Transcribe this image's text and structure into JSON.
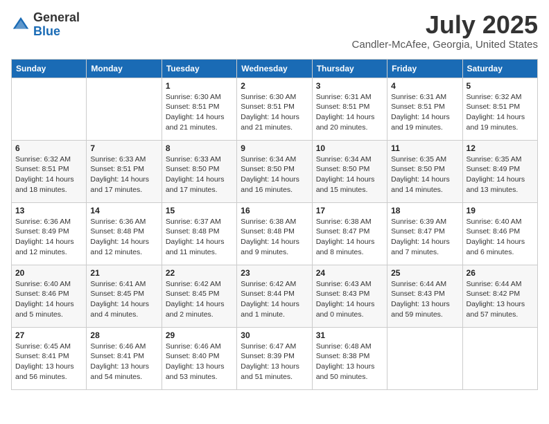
{
  "header": {
    "logo_general": "General",
    "logo_blue": "Blue",
    "month_title": "July 2025",
    "location": "Candler-McAfee, Georgia, United States"
  },
  "days_of_week": [
    "Sunday",
    "Monday",
    "Tuesday",
    "Wednesday",
    "Thursday",
    "Friday",
    "Saturday"
  ],
  "weeks": [
    [
      {
        "day": "",
        "info": ""
      },
      {
        "day": "",
        "info": ""
      },
      {
        "day": "1",
        "info": "Sunrise: 6:30 AM\nSunset: 8:51 PM\nDaylight: 14 hours and 21 minutes."
      },
      {
        "day": "2",
        "info": "Sunrise: 6:30 AM\nSunset: 8:51 PM\nDaylight: 14 hours and 21 minutes."
      },
      {
        "day": "3",
        "info": "Sunrise: 6:31 AM\nSunset: 8:51 PM\nDaylight: 14 hours and 20 minutes."
      },
      {
        "day": "4",
        "info": "Sunrise: 6:31 AM\nSunset: 8:51 PM\nDaylight: 14 hours and 19 minutes."
      },
      {
        "day": "5",
        "info": "Sunrise: 6:32 AM\nSunset: 8:51 PM\nDaylight: 14 hours and 19 minutes."
      }
    ],
    [
      {
        "day": "6",
        "info": "Sunrise: 6:32 AM\nSunset: 8:51 PM\nDaylight: 14 hours and 18 minutes."
      },
      {
        "day": "7",
        "info": "Sunrise: 6:33 AM\nSunset: 8:51 PM\nDaylight: 14 hours and 17 minutes."
      },
      {
        "day": "8",
        "info": "Sunrise: 6:33 AM\nSunset: 8:50 PM\nDaylight: 14 hours and 17 minutes."
      },
      {
        "day": "9",
        "info": "Sunrise: 6:34 AM\nSunset: 8:50 PM\nDaylight: 14 hours and 16 minutes."
      },
      {
        "day": "10",
        "info": "Sunrise: 6:34 AM\nSunset: 8:50 PM\nDaylight: 14 hours and 15 minutes."
      },
      {
        "day": "11",
        "info": "Sunrise: 6:35 AM\nSunset: 8:50 PM\nDaylight: 14 hours and 14 minutes."
      },
      {
        "day": "12",
        "info": "Sunrise: 6:35 AM\nSunset: 8:49 PM\nDaylight: 14 hours and 13 minutes."
      }
    ],
    [
      {
        "day": "13",
        "info": "Sunrise: 6:36 AM\nSunset: 8:49 PM\nDaylight: 14 hours and 12 minutes."
      },
      {
        "day": "14",
        "info": "Sunrise: 6:36 AM\nSunset: 8:48 PM\nDaylight: 14 hours and 12 minutes."
      },
      {
        "day": "15",
        "info": "Sunrise: 6:37 AM\nSunset: 8:48 PM\nDaylight: 14 hours and 11 minutes."
      },
      {
        "day": "16",
        "info": "Sunrise: 6:38 AM\nSunset: 8:48 PM\nDaylight: 14 hours and 9 minutes."
      },
      {
        "day": "17",
        "info": "Sunrise: 6:38 AM\nSunset: 8:47 PM\nDaylight: 14 hours and 8 minutes."
      },
      {
        "day": "18",
        "info": "Sunrise: 6:39 AM\nSunset: 8:47 PM\nDaylight: 14 hours and 7 minutes."
      },
      {
        "day": "19",
        "info": "Sunrise: 6:40 AM\nSunset: 8:46 PM\nDaylight: 14 hours and 6 minutes."
      }
    ],
    [
      {
        "day": "20",
        "info": "Sunrise: 6:40 AM\nSunset: 8:46 PM\nDaylight: 14 hours and 5 minutes."
      },
      {
        "day": "21",
        "info": "Sunrise: 6:41 AM\nSunset: 8:45 PM\nDaylight: 14 hours and 4 minutes."
      },
      {
        "day": "22",
        "info": "Sunrise: 6:42 AM\nSunset: 8:45 PM\nDaylight: 14 hours and 2 minutes."
      },
      {
        "day": "23",
        "info": "Sunrise: 6:42 AM\nSunset: 8:44 PM\nDaylight: 14 hours and 1 minute."
      },
      {
        "day": "24",
        "info": "Sunrise: 6:43 AM\nSunset: 8:43 PM\nDaylight: 14 hours and 0 minutes."
      },
      {
        "day": "25",
        "info": "Sunrise: 6:44 AM\nSunset: 8:43 PM\nDaylight: 13 hours and 59 minutes."
      },
      {
        "day": "26",
        "info": "Sunrise: 6:44 AM\nSunset: 8:42 PM\nDaylight: 13 hours and 57 minutes."
      }
    ],
    [
      {
        "day": "27",
        "info": "Sunrise: 6:45 AM\nSunset: 8:41 PM\nDaylight: 13 hours and 56 minutes."
      },
      {
        "day": "28",
        "info": "Sunrise: 6:46 AM\nSunset: 8:41 PM\nDaylight: 13 hours and 54 minutes."
      },
      {
        "day": "29",
        "info": "Sunrise: 6:46 AM\nSunset: 8:40 PM\nDaylight: 13 hours and 53 minutes."
      },
      {
        "day": "30",
        "info": "Sunrise: 6:47 AM\nSunset: 8:39 PM\nDaylight: 13 hours and 51 minutes."
      },
      {
        "day": "31",
        "info": "Sunrise: 6:48 AM\nSunset: 8:38 PM\nDaylight: 13 hours and 50 minutes."
      },
      {
        "day": "",
        "info": ""
      },
      {
        "day": "",
        "info": ""
      }
    ]
  ]
}
